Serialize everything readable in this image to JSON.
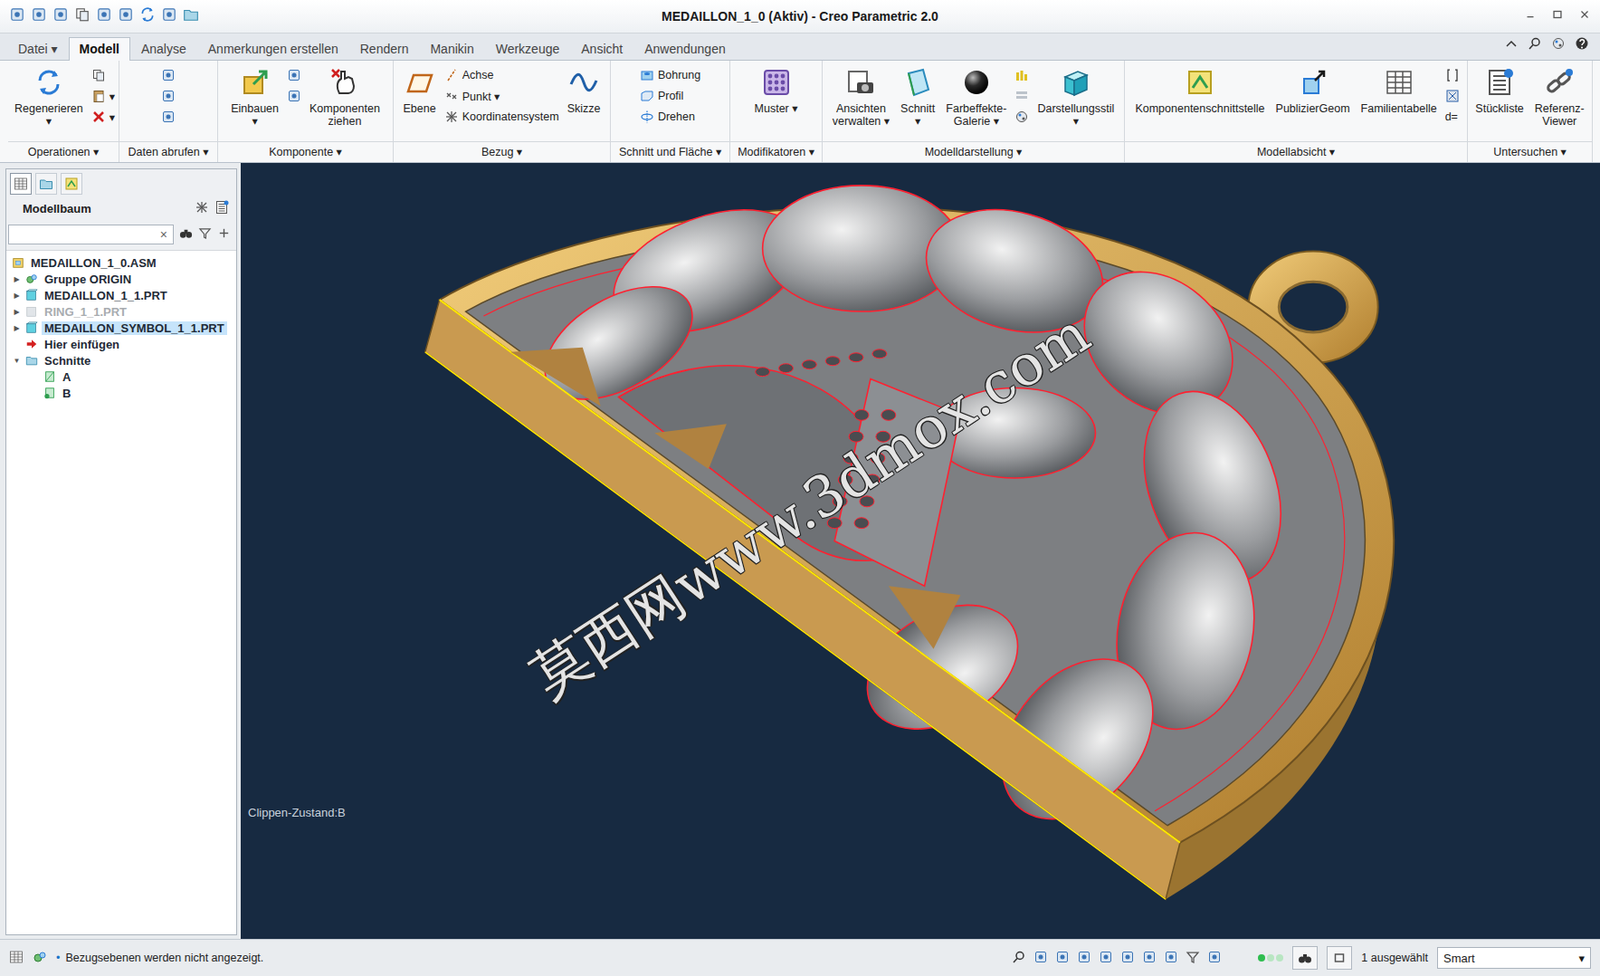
{
  "window": {
    "title": "MEDAILLON_1_0 (Aktiv) - Creo Parametric 2.0"
  },
  "tabs": [
    {
      "label": "Datei ▾",
      "selected": false
    },
    {
      "label": "Modell",
      "selected": true
    },
    {
      "label": "Analyse",
      "selected": false
    },
    {
      "label": "Anmerkungen erstellen",
      "selected": false
    },
    {
      "label": "Rendern",
      "selected": false
    },
    {
      "label": "Manikin",
      "selected": false
    },
    {
      "label": "Werkzeuge",
      "selected": false
    },
    {
      "label": "Ansicht",
      "selected": false
    },
    {
      "label": "Anwendungen",
      "selected": false
    }
  ],
  "ribbon": {
    "groups": [
      {
        "label": "Operationen ▾",
        "columns": [
          [
            {
              "kind": "large",
              "lines": [
                "Regenerieren",
                "▾"
              ]
            }
          ],
          [
            {
              "kind": "small"
            },
            {
              "kind": "small",
              "label": "▾"
            },
            {
              "kind": "small",
              "label": "▾"
            }
          ]
        ]
      },
      {
        "label": "Daten abrufen ▾",
        "columns": [
          [
            {
              "kind": "small"
            },
            {
              "kind": "small"
            },
            {
              "kind": "small"
            }
          ]
        ]
      },
      {
        "label": "Komponente ▾",
        "columns": [
          [
            {
              "kind": "large",
              "lines": [
                "Einbauen",
                "▾"
              ]
            }
          ],
          [
            {
              "kind": "small"
            },
            {
              "kind": "small"
            }
          ],
          [
            {
              "kind": "large",
              "lines": [
                "Komponenten",
                "ziehen"
              ]
            }
          ]
        ]
      },
      {
        "label": "Bezug ▾",
        "columns": [
          [
            {
              "kind": "large",
              "lines": [
                "Ebene"
              ]
            }
          ],
          [
            {
              "kind": "small",
              "label": "Achse"
            },
            {
              "kind": "small",
              "label": "Punkt ▾"
            },
            {
              "kind": "small",
              "label": "Koordinatensystem"
            }
          ],
          [
            {
              "kind": "large",
              "lines": [
                "Skizze"
              ]
            }
          ]
        ]
      },
      {
        "label": "Schnitt und Fläche ▾",
        "columns": [
          [
            {
              "kind": "small",
              "label": "Bohrung"
            },
            {
              "kind": "small",
              "label": "Profil"
            },
            {
              "kind": "small",
              "label": "Drehen"
            }
          ]
        ]
      },
      {
        "label": "Modifikatoren ▾",
        "columns": [
          [
            {
              "kind": "large",
              "lines": [
                "Muster ▾"
              ]
            }
          ]
        ]
      },
      {
        "label": "Modelldarstellung ▾",
        "columns": [
          [
            {
              "kind": "large",
              "lines": [
                "Ansichten",
                "verwalten ▾"
              ]
            }
          ],
          [
            {
              "kind": "large",
              "lines": [
                "Schnitt",
                "▾"
              ]
            }
          ],
          [
            {
              "kind": "large",
              "lines": [
                "Farbeffekte-",
                "Galerie ▾"
              ]
            }
          ],
          [
            {
              "kind": "small"
            },
            {
              "kind": "small"
            },
            {
              "kind": "small"
            }
          ],
          [
            {
              "kind": "large",
              "lines": [
                "Darstellungsstil",
                "▾"
              ]
            }
          ]
        ]
      },
      {
        "label": "Modellabsicht ▾",
        "columns": [
          [
            {
              "kind": "large",
              "lines": [
                "Komponentenschnittstelle"
              ]
            }
          ],
          [
            {
              "kind": "large",
              "lines": [
                "PublizierGeom"
              ]
            }
          ],
          [
            {
              "kind": "large",
              "lines": [
                "Familientabelle"
              ]
            }
          ],
          [
            {
              "kind": "small"
            },
            {
              "kind": "small"
            },
            {
              "kind": "text",
              "label": "d="
            }
          ]
        ]
      },
      {
        "label": "Untersuchen ▾",
        "columns": [
          [
            {
              "kind": "large",
              "lines": [
                "Stückliste"
              ]
            }
          ],
          [
            {
              "kind": "large",
              "lines": [
                "Referenz-",
                "Viewer"
              ]
            }
          ]
        ]
      }
    ]
  },
  "sidebar": {
    "tabs": [
      {
        "selected": true
      },
      {
        "selected": false
      },
      {
        "selected": false
      }
    ],
    "header": "Modellbaum",
    "search": {
      "value": "",
      "clear": "×"
    },
    "tree": [
      {
        "label": "MEDAILLON_1_0.ASM",
        "kind": "assembly",
        "expander": "",
        "selected": false,
        "disabled": false
      },
      {
        "label": "Gruppe ORIGIN",
        "kind": "group",
        "expander": "▶",
        "selected": false,
        "disabled": false
      },
      {
        "label": "MEDAILLON_1_1.PRT",
        "kind": "part",
        "expander": "▶",
        "selected": false,
        "disabled": false
      },
      {
        "label": "RING_1_1.PRT",
        "kind": "part",
        "expander": "▶",
        "selected": false,
        "disabled": true
      },
      {
        "label": "MEDAILLON_SYMBOL_1_1.PRT",
        "kind": "part",
        "expander": "▶",
        "selected": true,
        "disabled": false
      },
      {
        "label": "Hier einfügen",
        "kind": "insert",
        "expander": "",
        "selected": false,
        "disabled": false
      },
      {
        "label": "Schnitte",
        "kind": "folder",
        "expander": "▼",
        "selected": false,
        "disabled": false,
        "expanded": true,
        "children": [
          {
            "label": "A",
            "kind": "section",
            "selected": false,
            "disabled": false
          },
          {
            "label": "B",
            "kind": "section-active",
            "selected": false,
            "disabled": false
          }
        ]
      }
    ]
  },
  "viewport": {
    "clip_state": "Clippen-Zustand:B",
    "watermark": "莫西网www.3dmox.com"
  },
  "status_bar": {
    "bullet": "•",
    "message": "Bezugsebenen werden nicht angezeigt.",
    "selection": "1 ausgewählt",
    "filter": "Smart",
    "filter_caret": "▾"
  }
}
